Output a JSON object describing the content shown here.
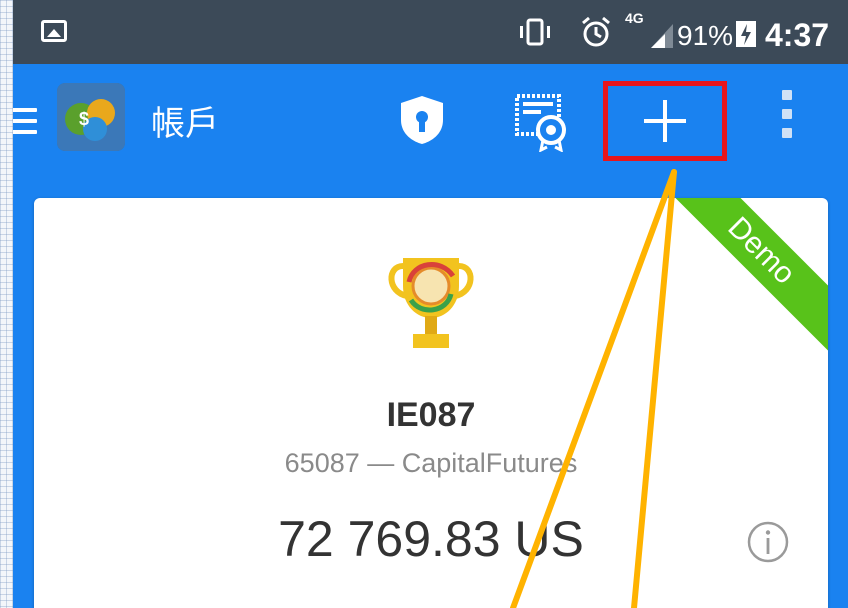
{
  "status_bar": {
    "network": "4G",
    "battery_percent": "91%",
    "time": "4:37",
    "icons": [
      "image-icon",
      "vibrate-icon",
      "alarm-icon",
      "signal-icon",
      "battery-charging-icon"
    ]
  },
  "app_bar": {
    "title": "帳戶",
    "actions": [
      "menu-icon",
      "app-logo-icon",
      "shield-lock-icon",
      "certificate-icon",
      "add-icon",
      "more-vertical-icon"
    ]
  },
  "account_card": {
    "badge": "Demo",
    "name": "IE087",
    "subtitle": "65087 — CapitalFutures",
    "balance": "72 769.83 US",
    "icons": [
      "trophy-icon",
      "info-icon"
    ]
  },
  "annotation": {
    "highlight_color": "#e8151b",
    "arrow_color": "#ffb300"
  },
  "colors": {
    "status_bar": "#3c4a58",
    "app_bar": "#1a82f0",
    "badge": "#58c21a"
  }
}
